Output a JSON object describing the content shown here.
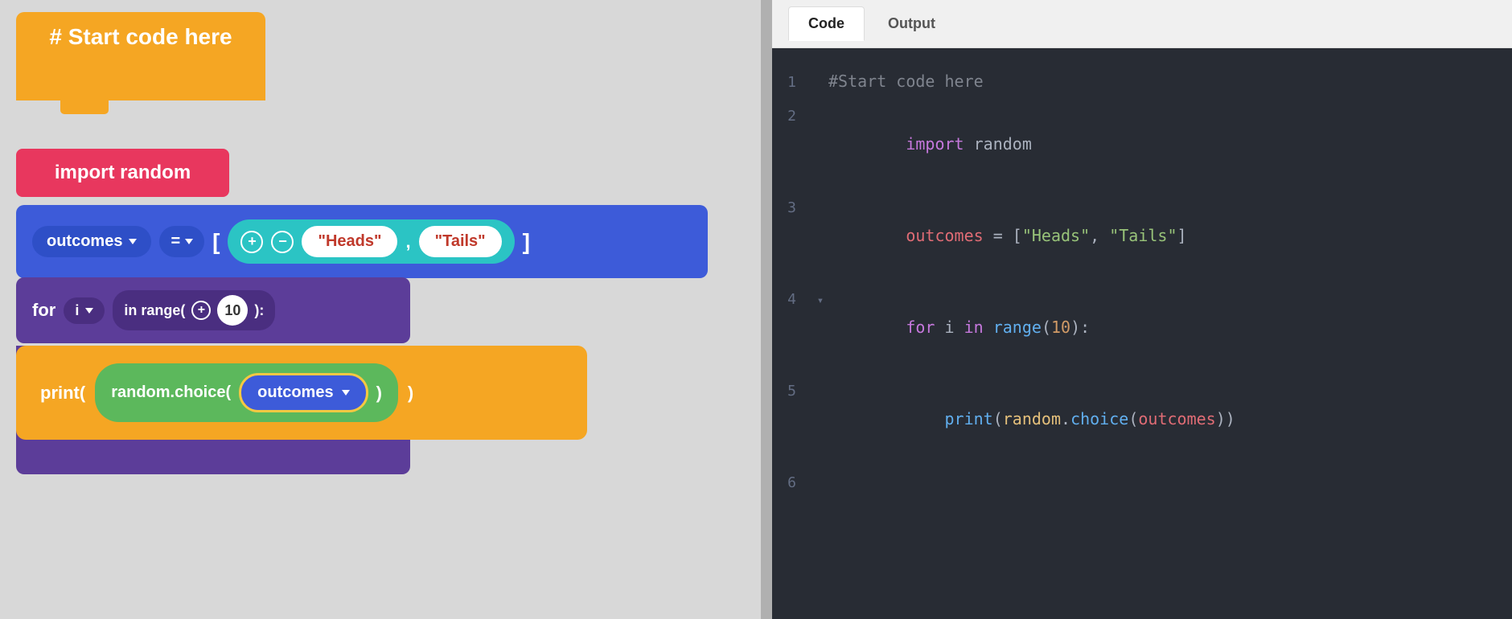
{
  "left_panel": {
    "bg_color": "#d8d8d8",
    "blocks": {
      "start": {
        "label": "# Start code here",
        "bg": "#f5a623"
      },
      "import": {
        "label": "import random",
        "bg": "#e8375e"
      },
      "assign": {
        "var_name": "outcomes",
        "operator": "=",
        "list_items": [
          "\"Heads\"",
          "\"Tails\""
        ],
        "bg": "#3d5bd9"
      },
      "for_loop": {
        "for_label": "for",
        "var": "i",
        "range_label": "in range(",
        "range_val": "10",
        "end_label": "):",
        "bg": "#5c3d99"
      },
      "print": {
        "label": "print(",
        "method": "random.choice(",
        "var": "outcomes",
        "bg_outer": "#f5a623",
        "bg_inner": "#5cb85c",
        "bg_var": "#3d5bd9"
      }
    }
  },
  "right_panel": {
    "tabs": [
      {
        "label": "Code",
        "active": true
      },
      {
        "label": "Output",
        "active": false
      }
    ],
    "code_lines": [
      {
        "num": "1",
        "has_arrow": false,
        "content": "#Start code here",
        "type": "comment"
      },
      {
        "num": "2",
        "has_arrow": false,
        "content": "import random",
        "type": "import"
      },
      {
        "num": "3",
        "has_arrow": false,
        "content": "outcomes = [\"Heads\", \"Tails\"]",
        "type": "assign"
      },
      {
        "num": "4",
        "has_arrow": true,
        "content": "for i in range(10):",
        "type": "for"
      },
      {
        "num": "5",
        "has_arrow": false,
        "content": "    print(random.choice(outcomes))",
        "type": "print"
      },
      {
        "num": "6",
        "has_arrow": false,
        "content": "",
        "type": "empty"
      }
    ]
  }
}
